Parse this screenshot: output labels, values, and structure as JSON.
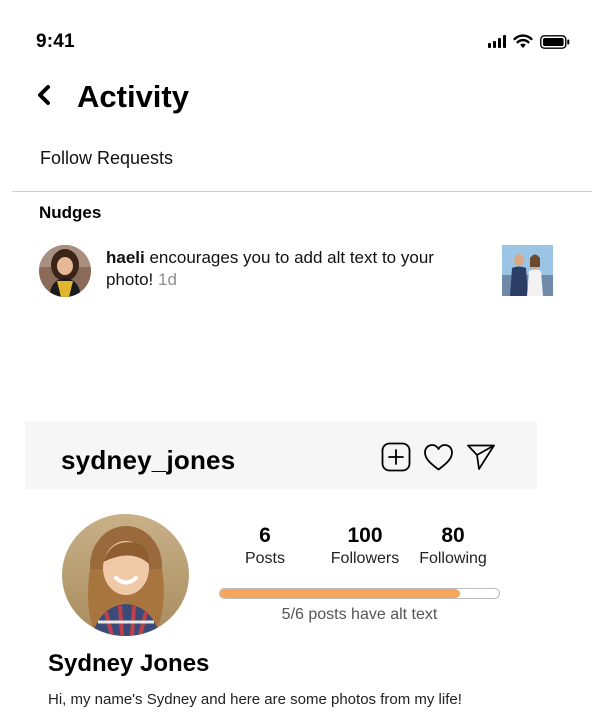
{
  "status_bar": {
    "time": "9:41",
    "icons": [
      "signal-icon",
      "wifi-icon",
      "battery-icon"
    ]
  },
  "activity": {
    "title": "Activity",
    "back_icon": "chevron-left-icon",
    "follow_requests_label": "Follow Requests",
    "nudges_heading": "Nudges",
    "nudge": {
      "username": "haeli",
      "message": " encourages you to add alt text to your photo!",
      "time_ago": " 1d",
      "avatar": "user-avatar-photo",
      "thumbnail": "post-thumbnail-photo"
    }
  },
  "profile": {
    "username": "sydney_jones",
    "header_icons": [
      "add-post-icon",
      "heart-icon",
      "send-icon"
    ],
    "stats": {
      "posts": {
        "value": "6",
        "label": "Posts"
      },
      "followers": {
        "value": "100",
        "label": "Followers"
      },
      "following": {
        "value": "80",
        "label": "Following"
      }
    },
    "alt_text_progress": {
      "fraction": 0.86,
      "label": "5/6 posts have alt text"
    },
    "display_name": "Sydney Jones",
    "bio": "Hi, my name's Sydney and here are some photos from my life!"
  },
  "colors": {
    "progress_fill": "#f6a55c",
    "header_bg": "#f6f6f6",
    "muted_text": "#8e8e8e"
  }
}
